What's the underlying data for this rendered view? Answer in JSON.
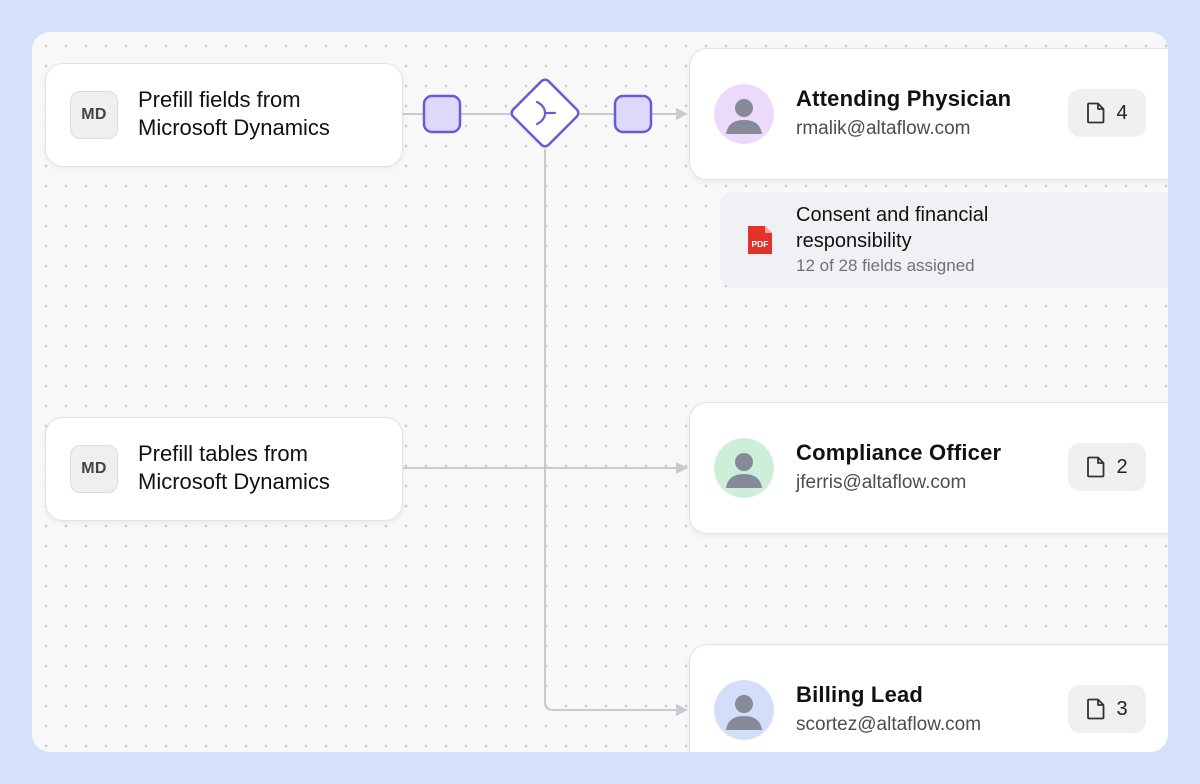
{
  "sources": [
    {
      "badge": "MD",
      "title_line1": "Prefill fields from",
      "title_line2": "Microsoft Dynamics"
    },
    {
      "badge": "MD",
      "title_line1": "Prefill tables from",
      "title_line2": "Microsoft Dynamics"
    }
  ],
  "recipients": [
    {
      "name": "Attending Physician",
      "email": "rmalik@altaflow.com",
      "doc_count": "4",
      "avatar_color": "#ecdafb"
    },
    {
      "name": "Compliance Officer",
      "email": "jferris@altaflow.com",
      "doc_count": "2",
      "avatar_color": "#cdefd9"
    },
    {
      "name": "Billing Lead",
      "email": "scortez@altaflow.com",
      "doc_count": "3",
      "avatar_color": "#d3dffa"
    }
  ],
  "document": {
    "title_line1": "Consent and financial",
    "title_line2": "responsibility",
    "fields_assigned": "12 of 28 fields assigned",
    "file_type": "PDF"
  },
  "colors": {
    "accent": "#6a5ad8",
    "node_fill": "#dcd9fb",
    "connector": "#c8cacf",
    "pdf_red": "#e4322b",
    "avatar_figure": "#858a99"
  },
  "icons": {
    "source_badge": "md-badge",
    "decision": "split-diamond-icon",
    "document_count": "document-icon",
    "file": "pdf-icon",
    "avatar": "user-avatar-icon"
  }
}
